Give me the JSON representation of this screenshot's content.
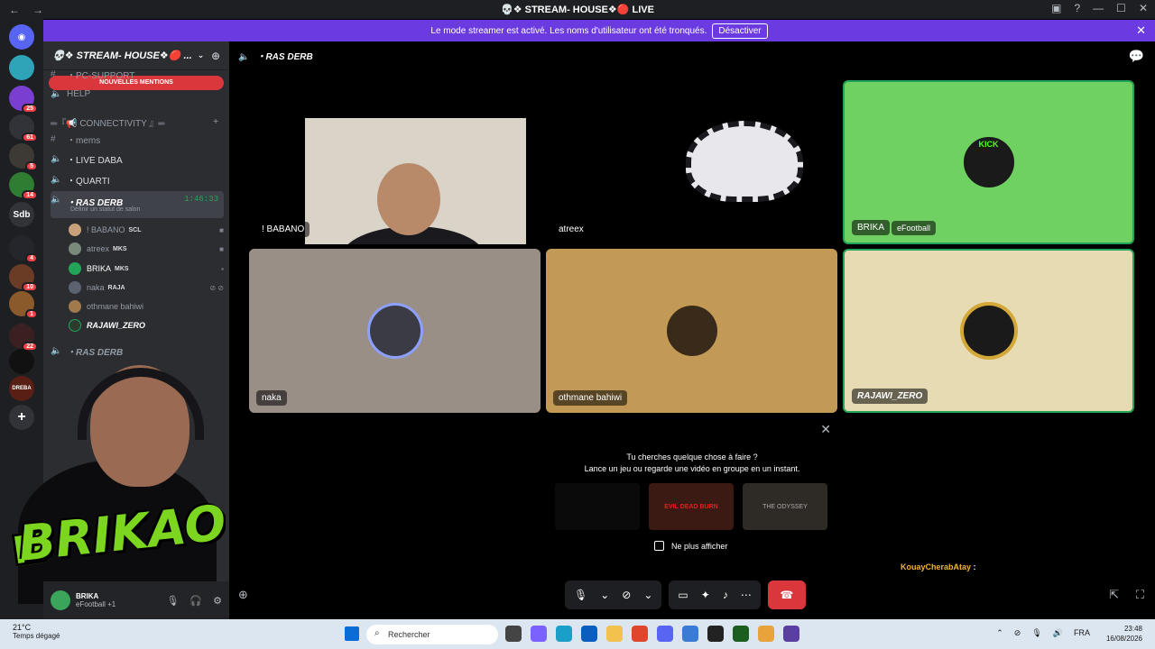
{
  "window": {
    "title": "💀❖ STREAM- HOUSE❖🔴 LIVE",
    "back": "←",
    "forward": "→"
  },
  "banner": {
    "text": "Le mode streamer est activé. Les noms d'utilisateur ont été tronqués.",
    "button": "Désactiver",
    "close": "✕"
  },
  "rail": {
    "servers": [
      {
        "label": "",
        "badge": "25"
      },
      {
        "label": "",
        "badge": "61"
      },
      {
        "label": "",
        "badge": "5"
      },
      {
        "label": "",
        "badge": "14"
      },
      {
        "label": "Sdb",
        "badge": ""
      },
      {
        "label": "",
        "badge": "4"
      },
      {
        "label": "",
        "badge": "10"
      },
      {
        "label": "",
        "badge": "1"
      },
      {
        "label": "",
        "badge": "22"
      },
      {
        "label": "",
        "badge": ""
      },
      {
        "label": "DREBA",
        "badge": ""
      }
    ],
    "add": "+"
  },
  "sidebar": {
    "server_name": "💀❖ STREAM- HOUSE❖🔴 ...",
    "mentions": "NOUVELLES MENTIONS",
    "channels": [
      {
        "name": "・PC-SUPPORT",
        "icon": "#"
      },
      {
        "name": "HELP",
        "icon": "🔈"
      },
      {
        "name": "═『📢 CONNECTIVITY 』═",
        "icon": ""
      },
      {
        "name": "・mems",
        "icon": "#"
      },
      {
        "name": "・LIVE DABA",
        "icon": "🔈"
      },
      {
        "name": "・QUARTI",
        "icon": "🔈"
      },
      {
        "name": "・RAS DERB",
        "icon": "🔈",
        "time": "1:46:33",
        "status": "Définir un statut de salon"
      },
      {
        "name": "・RAS DERB",
        "icon": "🔈"
      }
    ],
    "users": [
      {
        "name": "! BABANO",
        "tag": "SCL"
      },
      {
        "name": "atreex",
        "tag": "MKS"
      },
      {
        "name": "BRIKA",
        "tag": "MKS"
      },
      {
        "name": "naka",
        "tag": "RAJA"
      },
      {
        "name": "othmane bahiwi",
        "tag": ""
      },
      {
        "name": "RAJAWI_ZERO",
        "tag": ""
      }
    ]
  },
  "userpanel": {
    "name": "BRIKA",
    "activity": "eFootball +1"
  },
  "webcam": {
    "logo": "BRIKAO",
    "k": "K"
  },
  "stage": {
    "channel": "・RAS DERB",
    "tiles": [
      {
        "name": "! BABANO"
      },
      {
        "name": "atreex"
      },
      {
        "name": "BRIKA",
        "activity": "eFootball"
      },
      {
        "name": "naka"
      },
      {
        "name": "othmane bahiwi"
      },
      {
        "name": "RAJAWI_ZERO"
      }
    ],
    "brand_text": "KICK"
  },
  "activity": {
    "line1": "Tu cherches quelque chose à faire ?",
    "line2": "Lance un jeu ou regarde une vidéo en groupe en un instant.",
    "cards": [
      "",
      "EVIL DEAD BURN",
      "THE ODYSSEY"
    ],
    "checkbox": "Ne plus afficher"
  },
  "chat": {
    "user": "KouayCherabAtay",
    "sep": " :"
  },
  "taskbar": {
    "temp": "21°C",
    "weather": "Temps dégagé",
    "search": "Rechercher",
    "lang": "FRA",
    "time": "23:48",
    "date": "16/08/2026"
  },
  "colors": {
    "accent": "#5865f2",
    "banner": "#6b3ae0",
    "speaking": "#23a559",
    "hangup": "#da373c",
    "tile_brika": "#6fd162",
    "tile_naka": "#9a8f87",
    "tile_othmane": "#c29a55",
    "tile_rajawi": "#e6dbb2"
  }
}
